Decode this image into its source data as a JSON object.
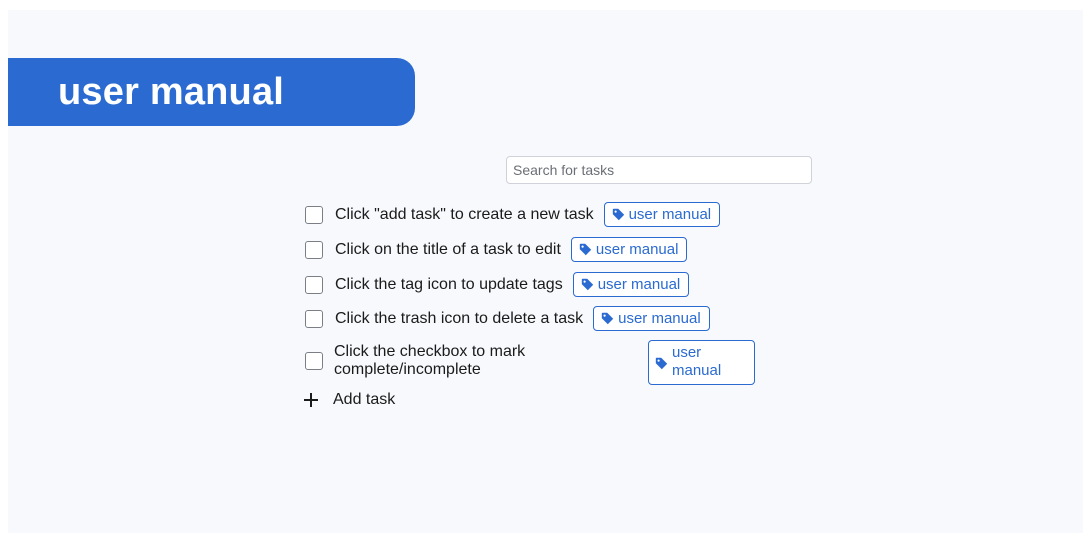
{
  "header": {
    "title": "user manual"
  },
  "search": {
    "placeholder": "Search for tasks",
    "value": ""
  },
  "tasks": [
    {
      "title": "Click \"add task\" to create a new task",
      "tag": "user manual",
      "completed": false
    },
    {
      "title": "Click on the title of a task to edit",
      "tag": "user manual",
      "completed": false
    },
    {
      "title": "Click the tag icon to update tags",
      "tag": "user manual",
      "completed": false
    },
    {
      "title": "Click the trash icon to delete a task",
      "tag": "user manual",
      "completed": false
    },
    {
      "title": "Click the checkbox to mark complete/incomplete",
      "tag": "user manual",
      "completed": false
    }
  ],
  "add_task": {
    "label": "Add task",
    "icon": "plus-icon"
  },
  "colors": {
    "accent": "#2b6bd1",
    "background": "#f7f9fc"
  }
}
